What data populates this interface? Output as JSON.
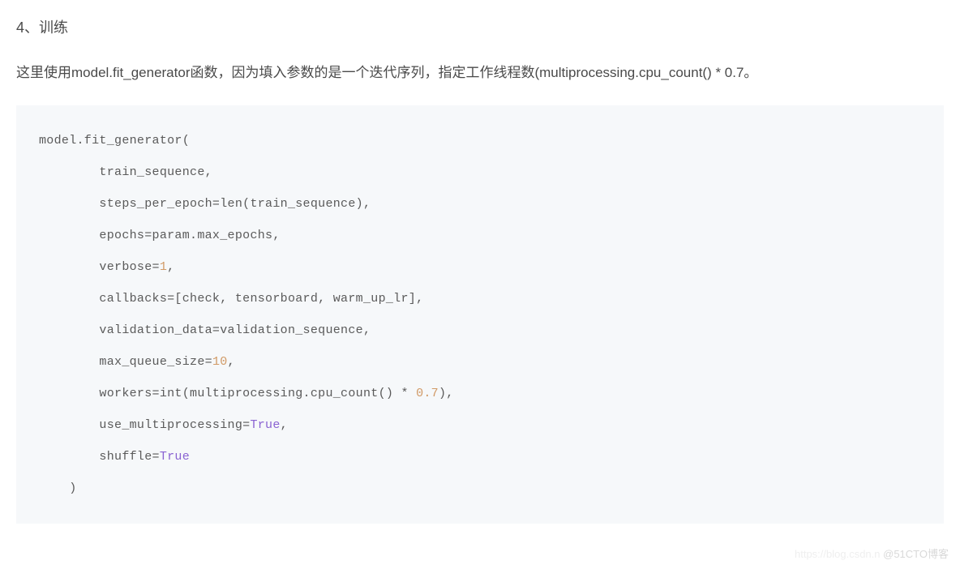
{
  "heading": "4、训练",
  "description": "这里使用model.fit_generator函数，因为填入参数的是一个迭代序列，指定工作线程数(multiprocessing.cpu_count() * 0.7。",
  "code": {
    "line1": "model.fit_generator(",
    "line2_a": "        train_sequence,",
    "line3_a": "        steps_per_epoch=len(train_sequence),",
    "line4_a": "        epochs=param.max_epochs,",
    "line5_a": "        verbose=",
    "line5_num": "1",
    "line5_b": ",",
    "line6_a": "        callbacks=[check, tensorboard, warm_up_lr],",
    "line7_a": "        validation_data=validation_sequence,",
    "line8_a": "        max_queue_size=",
    "line8_num": "10",
    "line8_b": ",",
    "line9_a": "        workers=int(multiprocessing.cpu_count() * ",
    "line9_num": "0.7",
    "line9_b": "),",
    "line10_a": "        use_multiprocessing=",
    "line10_bool": "True",
    "line10_b": ",",
    "line11_a": "        shuffle=",
    "line11_bool": "True",
    "line12": "    )"
  },
  "watermark": {
    "faint": "https://blog.csdn.n",
    "main": "@51CTO博客"
  }
}
